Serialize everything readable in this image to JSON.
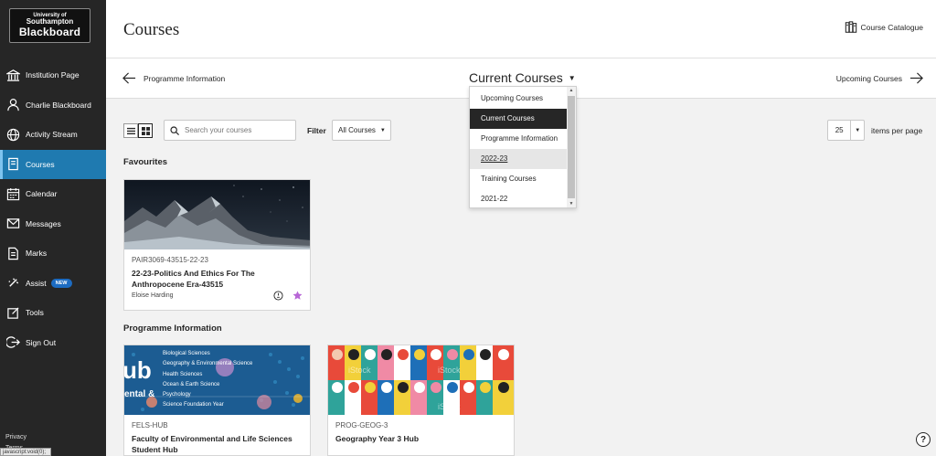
{
  "sidebar": {
    "logo": {
      "university": "University of",
      "name": "Southampton",
      "product": "Blackboard"
    },
    "items": [
      {
        "label": "Institution Page",
        "icon": "institution-icon"
      },
      {
        "label": "Charlie Blackboard",
        "icon": "user-icon"
      },
      {
        "label": "Activity Stream",
        "icon": "globe-icon"
      },
      {
        "label": "Courses",
        "icon": "courses-icon",
        "active": true
      },
      {
        "label": "Calendar",
        "icon": "calendar-icon"
      },
      {
        "label": "Messages",
        "icon": "envelope-icon"
      },
      {
        "label": "Marks",
        "icon": "marks-icon"
      },
      {
        "label": "Assist",
        "icon": "assist-icon",
        "badge": "NEW"
      },
      {
        "label": "Tools",
        "icon": "tools-icon"
      },
      {
        "label": "Sign Out",
        "icon": "sign-out-icon"
      }
    ],
    "footer": {
      "privacy": "Privacy",
      "terms": "Terms"
    },
    "status_tip": "javascript:void(0);"
  },
  "header": {
    "title": "Courses",
    "catalogue_label": "Course Catalogue"
  },
  "subnav": {
    "prev_label": "Programme Information",
    "current_label": "Current Courses",
    "next_label": "Upcoming Courses"
  },
  "term_dropdown": {
    "options": [
      "Upcoming Courses",
      "Current Courses",
      "Programme Information",
      "2022-23",
      "Training Courses",
      "2021-22"
    ],
    "selected": "Current Courses",
    "hovered": "2022-23"
  },
  "toolbar": {
    "search_placeholder": "Search your courses",
    "filter_label": "Filter",
    "filter_value": "All Courses",
    "per_page_value": "25",
    "per_page_label": "items per page"
  },
  "sections": {
    "favourites": "Favourites",
    "programme_information": "Programme Information"
  },
  "favourite_course": {
    "code": "PAIR3069-43515-22-23",
    "title": "22-23-Politics And Ethics For The Anthropocene Era-43515",
    "instructor": "Eloise Harding",
    "favourited": true
  },
  "programme_courses": [
    {
      "code": "FELS-HUB",
      "title": "Faculty of Environmental and Life Sciences Student Hub",
      "banner_text": [
        "Biological Sciences",
        "Geography & Environmental Science",
        "Health Sciences",
        "Ocean & Earth Science",
        "Psychology",
        "Science Foundation Year"
      ],
      "banner_big": "ub",
      "banner_sub": "ental &"
    },
    {
      "code": "PROG-GEOG-3",
      "title": "Geography Year 3 Hub",
      "watermark": "iStock"
    }
  ],
  "colors": {
    "sidebar_bg": "#262626",
    "active_nav": "#1f7ab0",
    "star": "#b766d6"
  }
}
